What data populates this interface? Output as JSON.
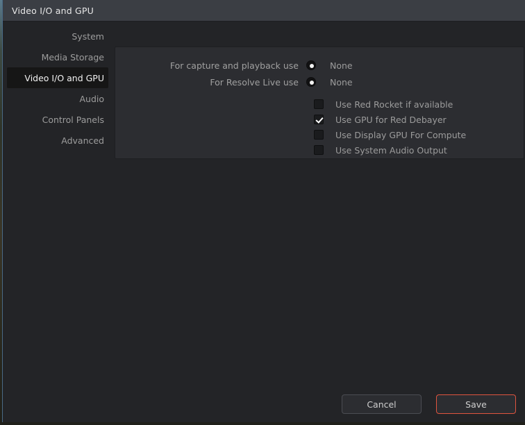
{
  "window": {
    "title": "Video I/O and GPU"
  },
  "sidebar": {
    "items": [
      {
        "label": "System",
        "selected": false
      },
      {
        "label": "Media Storage",
        "selected": false
      },
      {
        "label": "Video I/O and GPU",
        "selected": true
      },
      {
        "label": "Audio",
        "selected": false
      },
      {
        "label": "Control Panels",
        "selected": false
      },
      {
        "label": "Advanced",
        "selected": false
      }
    ]
  },
  "panel": {
    "radio_rows": [
      {
        "label": "For capture and playback use",
        "value": "None",
        "selected": true
      },
      {
        "label": "For Resolve Live use",
        "value": "None",
        "selected": true
      }
    ],
    "checkboxes": [
      {
        "label": "Use Red Rocket if available",
        "checked": false
      },
      {
        "label": "Use GPU for Red Debayer",
        "checked": true
      },
      {
        "label": "Use Display GPU For Compute",
        "checked": false
      },
      {
        "label": "Use System Audio Output",
        "checked": false
      }
    ]
  },
  "footer": {
    "cancel_label": "Cancel",
    "save_label": "Save"
  },
  "colors": {
    "accent": "#e0553f",
    "dialog_background": "#232427",
    "panel_background": "#2c2d31",
    "titlebar_background": "#3b3e44",
    "selected_nav_background": "#161616",
    "label_text": "#9c9c9c",
    "title_text": "#e8e8e8"
  }
}
